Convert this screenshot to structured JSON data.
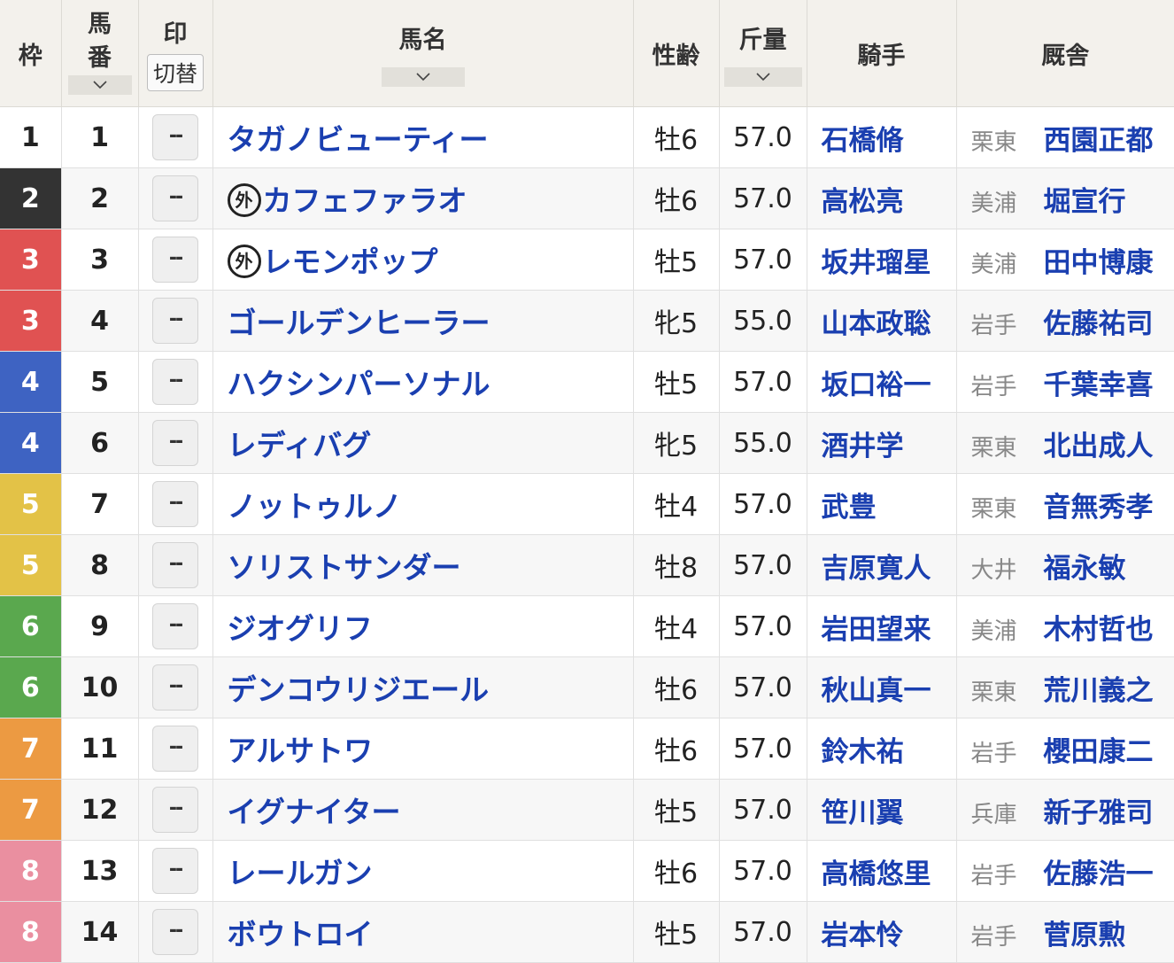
{
  "header": {
    "waku": "枠",
    "umaban_1": "馬",
    "umaban_2": "番",
    "mark": "印",
    "mark_toggle": "切替",
    "name": "馬名",
    "sex_age": "性齢",
    "weight": "斤量",
    "jockey": "騎手",
    "stable": "厩舎"
  },
  "mark_placeholder": "--",
  "gai_label": "外",
  "colors": {
    "waku_1": "#ffffff",
    "waku_2": "#333333",
    "waku_3": "#e05252",
    "waku_4": "#3e63c2",
    "waku_5": "#e3c247",
    "waku_6": "#5aa84e",
    "waku_7": "#ec9a42",
    "waku_8": "#ea8fa0",
    "link": "#1a3fb0"
  },
  "rows": [
    {
      "waku": "1",
      "umaban": "1",
      "gai": false,
      "name": "タガノビューティー",
      "sex_age": "牡6",
      "weight": "57.0",
      "jockey": "石橋脩",
      "area": "栗東",
      "trainer": "西園正都"
    },
    {
      "waku": "2",
      "umaban": "2",
      "gai": true,
      "name": "カフェファラオ",
      "sex_age": "牡6",
      "weight": "57.0",
      "jockey": "高松亮",
      "area": "美浦",
      "trainer": "堀宣行"
    },
    {
      "waku": "3",
      "umaban": "3",
      "gai": true,
      "name": "レモンポップ",
      "sex_age": "牡5",
      "weight": "57.0",
      "jockey": "坂井瑠星",
      "area": "美浦",
      "trainer": "田中博康"
    },
    {
      "waku": "3",
      "umaban": "4",
      "gai": false,
      "name": "ゴールデンヒーラー",
      "sex_age": "牝5",
      "weight": "55.0",
      "jockey": "山本政聡",
      "area": "岩手",
      "trainer": "佐藤祐司"
    },
    {
      "waku": "4",
      "umaban": "5",
      "gai": false,
      "name": "ハクシンパーソナル",
      "sex_age": "牡5",
      "weight": "57.0",
      "jockey": "坂口裕一",
      "area": "岩手",
      "trainer": "千葉幸喜"
    },
    {
      "waku": "4",
      "umaban": "6",
      "gai": false,
      "name": "レディバグ",
      "sex_age": "牝5",
      "weight": "55.0",
      "jockey": "酒井学",
      "area": "栗東",
      "trainer": "北出成人"
    },
    {
      "waku": "5",
      "umaban": "7",
      "gai": false,
      "name": "ノットゥルノ",
      "sex_age": "牡4",
      "weight": "57.0",
      "jockey": "武豊",
      "area": "栗東",
      "trainer": "音無秀孝"
    },
    {
      "waku": "5",
      "umaban": "8",
      "gai": false,
      "name": "ソリストサンダー",
      "sex_age": "牡8",
      "weight": "57.0",
      "jockey": "吉原寛人",
      "area": "大井",
      "trainer": "福永敏"
    },
    {
      "waku": "6",
      "umaban": "9",
      "gai": false,
      "name": "ジオグリフ",
      "sex_age": "牡4",
      "weight": "57.0",
      "jockey": "岩田望来",
      "area": "美浦",
      "trainer": "木村哲也"
    },
    {
      "waku": "6",
      "umaban": "10",
      "gai": false,
      "name": "デンコウリジエール",
      "sex_age": "牡6",
      "weight": "57.0",
      "jockey": "秋山真一",
      "area": "栗東",
      "trainer": "荒川義之"
    },
    {
      "waku": "7",
      "umaban": "11",
      "gai": false,
      "name": "アルサトワ",
      "sex_age": "牡6",
      "weight": "57.0",
      "jockey": "鈴木祐",
      "area": "岩手",
      "trainer": "櫻田康二"
    },
    {
      "waku": "7",
      "umaban": "12",
      "gai": false,
      "name": "イグナイター",
      "sex_age": "牡5",
      "weight": "57.0",
      "jockey": "笹川翼",
      "area": "兵庫",
      "trainer": "新子雅司"
    },
    {
      "waku": "8",
      "umaban": "13",
      "gai": false,
      "name": "レールガン",
      "sex_age": "牡6",
      "weight": "57.0",
      "jockey": "高橋悠里",
      "area": "岩手",
      "trainer": "佐藤浩一"
    },
    {
      "waku": "8",
      "umaban": "14",
      "gai": false,
      "name": "ボウトロイ",
      "sex_age": "牡5",
      "weight": "57.0",
      "jockey": "岩本怜",
      "area": "岩手",
      "trainer": "菅原勲"
    }
  ]
}
